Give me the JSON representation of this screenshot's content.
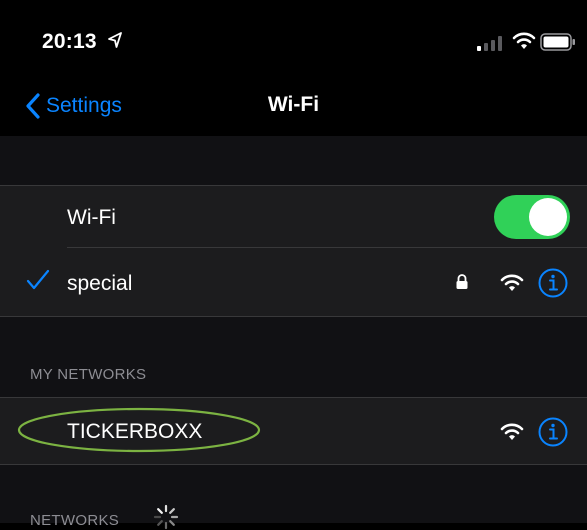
{
  "status_bar": {
    "time": "20:13",
    "location_icon": "location-arrow-icon",
    "signal_icon": "cellular-signal-icon",
    "wifi_icon": "wifi-icon",
    "battery_icon": "battery-icon"
  },
  "nav": {
    "back_label": "Settings",
    "title": "Wi-Fi"
  },
  "wifi_toggle": {
    "label": "Wi-Fi",
    "on": true
  },
  "connected_network": {
    "name": "special",
    "secured": true
  },
  "my_networks": {
    "header": "MY NETWORKS",
    "items": [
      {
        "name": "TICKERBOXX"
      }
    ]
  },
  "networks": {
    "header": "NETWORKS"
  },
  "colors": {
    "accent": "#0a84ff",
    "toggle_on": "#30d158",
    "annotation": "#7cb342"
  }
}
